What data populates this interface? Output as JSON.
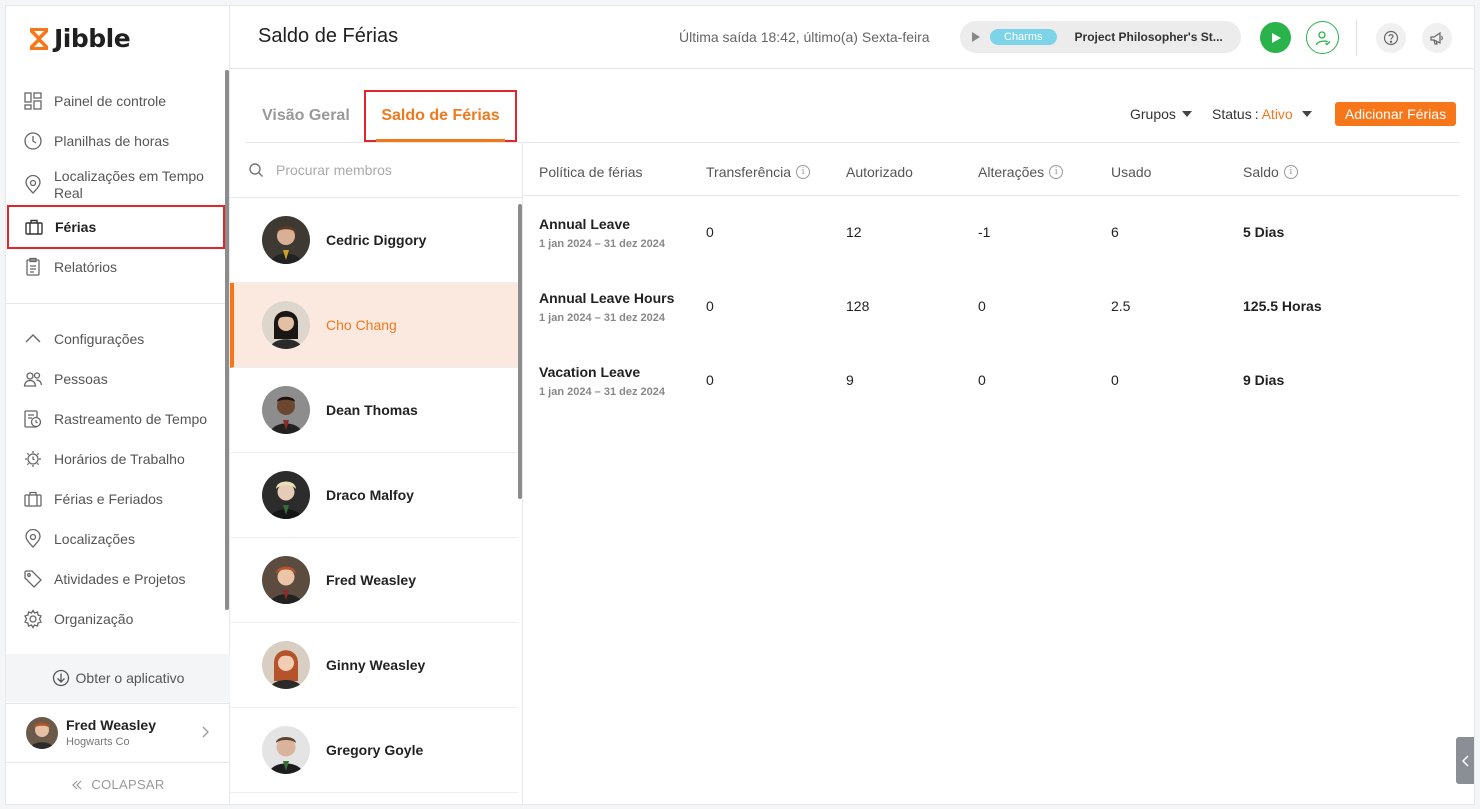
{
  "app": {
    "logo_text": "Jibble"
  },
  "colors": {
    "accent": "#f7761a",
    "highlight_border": "#e0262a",
    "green": "#29b34a",
    "selected_bg": "#fbe9e0"
  },
  "sidebar": {
    "items": [
      {
        "label": "Painel de controle",
        "icon": "dashboard-icon"
      },
      {
        "label": "Planilhas de horas",
        "icon": "clock-icon"
      },
      {
        "label": "Localizações em Tempo Real",
        "icon": "location-pin-icon"
      },
      {
        "label": "Férias",
        "icon": "briefcase-icon"
      },
      {
        "label": "Relatórios",
        "icon": "clipboard-icon"
      }
    ],
    "settings_items": [
      {
        "label": "Configurações",
        "icon": "chevron-up-icon"
      },
      {
        "label": "Pessoas",
        "icon": "people-icon"
      },
      {
        "label": "Rastreamento de Tempo",
        "icon": "time-tracking-icon"
      },
      {
        "label": "Horários de Trabalho",
        "icon": "work-schedule-icon"
      },
      {
        "label": "Férias e Feriados",
        "icon": "briefcase-icon"
      },
      {
        "label": "Localizações",
        "icon": "location-pin-icon"
      },
      {
        "label": "Atividades e Projetos",
        "icon": "tag-icon"
      },
      {
        "label": "Organização",
        "icon": "gear-icon"
      }
    ],
    "get_app": "Obter o aplicativo",
    "user": {
      "name": "Fred Weasley",
      "org": "Hogwarts Co"
    },
    "collapse": "COLAPSAR"
  },
  "header": {
    "title": "Saldo de Férias",
    "last_out": "Última saída 18:42, último(a) Sexta-feira",
    "timer": {
      "badge": "Charms",
      "project": "Project Philosopher's St..."
    }
  },
  "tabs": {
    "overview": "Visão Geral",
    "balance": "Saldo de Férias"
  },
  "filters": {
    "groups": "Grupos",
    "status_label": "Status",
    "status_value": "Ativo",
    "add_button": "Adicionar Férias"
  },
  "search": {
    "placeholder": "Procurar membros"
  },
  "members": [
    {
      "name": "Cedric Diggory",
      "selected": false
    },
    {
      "name": "Cho Chang",
      "selected": true
    },
    {
      "name": "Dean Thomas",
      "selected": false
    },
    {
      "name": "Draco Malfoy",
      "selected": false
    },
    {
      "name": "Fred Weasley",
      "selected": false
    },
    {
      "name": "Ginny Weasley",
      "selected": false
    },
    {
      "name": "Gregory Goyle",
      "selected": false
    }
  ],
  "table": {
    "columns": [
      "Política de férias",
      "Transferência",
      "Autorizado",
      "Alterações",
      "Usado",
      "Saldo"
    ],
    "rows": [
      {
        "policy": "Annual Leave",
        "dates": "1 jan 2024 – 31 dez 2024",
        "transfer": "0",
        "authorized": "12",
        "changes": "-1",
        "used": "6",
        "balance": "5 Dias"
      },
      {
        "policy": "Annual Leave Hours",
        "dates": "1 jan 2024 – 31 dez 2024",
        "transfer": "0",
        "authorized": "128",
        "changes": "0",
        "used": "2.5",
        "balance": "125.5 Horas"
      },
      {
        "policy": "Vacation Leave",
        "dates": "1 jan 2024 – 31 dez 2024",
        "transfer": "0",
        "authorized": "9",
        "changes": "0",
        "used": "0",
        "balance": "9 Dias"
      }
    ]
  }
}
